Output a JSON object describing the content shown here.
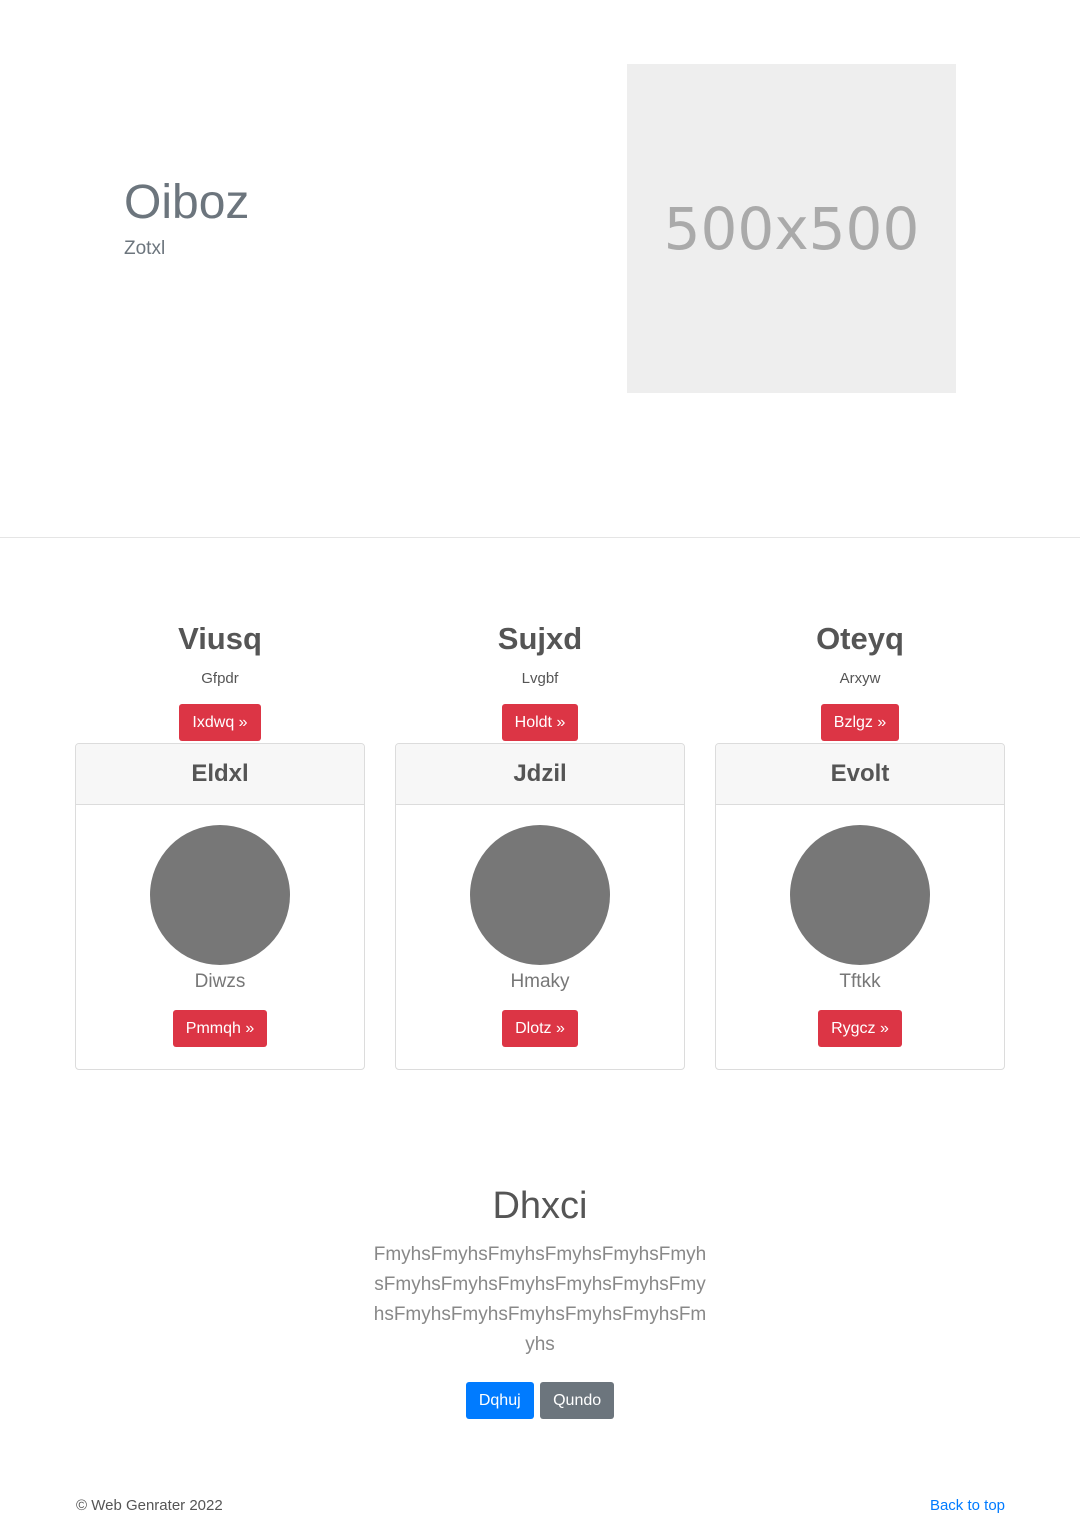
{
  "hero": {
    "title": "Oiboz",
    "subtitle": "Zotxl",
    "image_label": "500x500"
  },
  "features": [
    {
      "title": "Viusq",
      "subtitle": "Gfpdr",
      "button": "Ixdwq »"
    },
    {
      "title": "Sujxd",
      "subtitle": "Lvgbf",
      "button": "Holdt »"
    },
    {
      "title": "Oteyq",
      "subtitle": "Arxyw",
      "button": "Bzlgz »"
    }
  ],
  "cards": [
    {
      "header": "Eldxl",
      "caption": "Diwzs",
      "button": "Pmmqh »"
    },
    {
      "header": "Jdzil",
      "caption": "Hmaky",
      "button": "Dlotz »"
    },
    {
      "header": "Evolt",
      "caption": "Tftkk",
      "button": "Rygcz »"
    }
  ],
  "callout": {
    "title": "Dhxci",
    "text": "FmyhsFmyhsFmyhsFmyhsFmyhsFmyhsFmyhsFmyhsFmyhsFmyhsFmyhsFmyhsFmyhsFmyhsFmyhsFmyhsFmyhsFmyhs",
    "primary_button": "Dqhuj",
    "secondary_button": "Qundo"
  },
  "footer": {
    "copyright": "© Web Genrater 2022",
    "back_to_top": "Back to top"
  },
  "colors": {
    "danger": "#dc3545",
    "primary": "#007bff",
    "secondary": "#6c757d",
    "avatar": "#777777",
    "placeholder": "#eeeeee"
  }
}
